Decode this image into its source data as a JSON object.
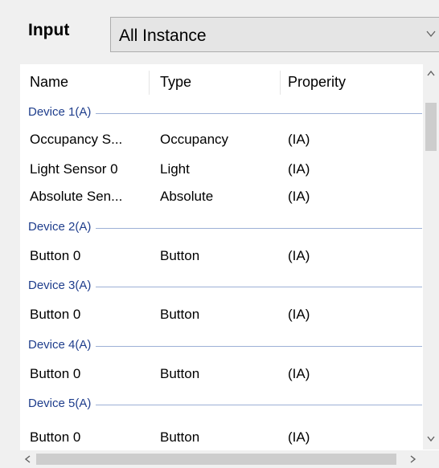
{
  "header": {
    "input_label": "Input",
    "combo_value": "All Instance"
  },
  "columns": [
    "Name",
    "Type",
    "Properity"
  ],
  "groups": [
    {
      "label": "Device 1(A)",
      "rows": [
        {
          "name": "Occupancy S...",
          "type": "Occupancy",
          "property": "(IA)"
        },
        {
          "name": "Light Sensor 0",
          "type": "Light",
          "property": "(IA)"
        },
        {
          "name": "Absolute Sen...",
          "type": "Absolute",
          "property": "(IA)"
        }
      ]
    },
    {
      "label": "Device 2(A)",
      "rows": [
        {
          "name": "Button 0",
          "type": "Button",
          "property": "(IA)"
        }
      ]
    },
    {
      "label": "Device 3(A)",
      "rows": [
        {
          "name": "Button 0",
          "type": "Button",
          "property": "(IA)"
        }
      ]
    },
    {
      "label": "Device 4(A)",
      "rows": [
        {
          "name": "Button 0",
          "type": "Button",
          "property": "(IA)"
        }
      ]
    },
    {
      "label": "Device 5(A)",
      "rows": [
        {
          "name": "Button 0",
          "type": "Button",
          "property": "(IA)"
        }
      ]
    }
  ],
  "icons": {
    "combo_arrow": "chevron-down-icon",
    "scroll_up": "chevron-up-icon",
    "scroll_down": "chevron-down-icon",
    "scroll_left": "chevron-left-icon",
    "scroll_right": "chevron-right-icon"
  },
  "colors": {
    "group_label": "#1e3d8c",
    "group_line": "#9db0d6",
    "list_background": "#ffffff",
    "panel_background": "#f0f0f0"
  }
}
